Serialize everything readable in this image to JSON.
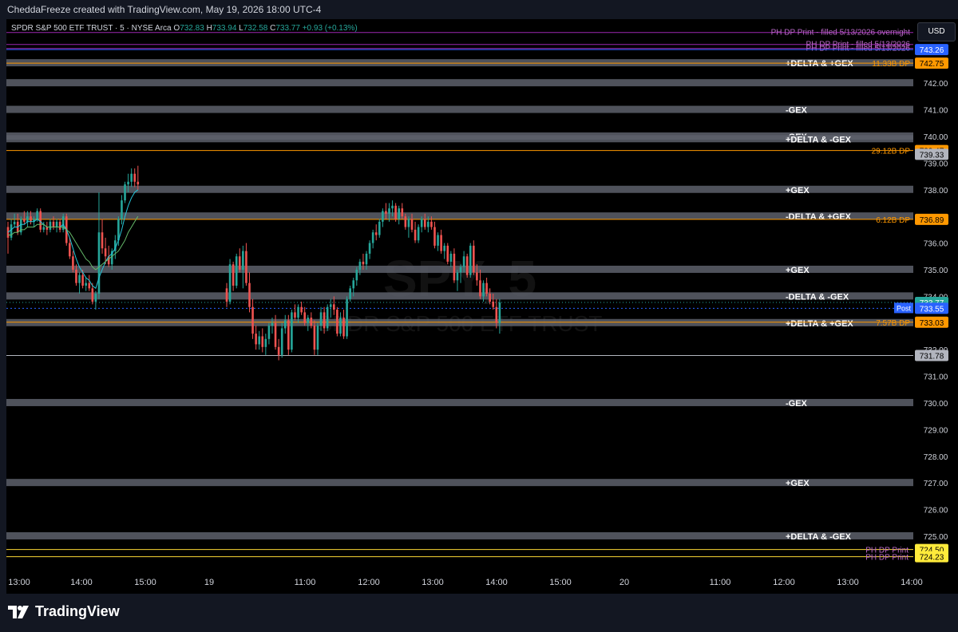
{
  "app": {
    "creator_line": "CheddaFreeze created with TradingView.com, May 19, 2026 18:00 UTC-4",
    "brand": "TradingView"
  },
  "symbol": {
    "name": "SPDR S&P 500 ETF TRUST · 5 · NYSE Arca",
    "open_label": "O",
    "open": "732.83",
    "high_label": "H",
    "high": "733.94",
    "low_label": "L",
    "low": "732.58",
    "close_label": "C",
    "close": "733.77",
    "change": "+0.93 (+0.13%)",
    "watermark_ticker": "SPY, 5",
    "watermark_name": "SPDR S&P 500 ETF TRUST"
  },
  "price_scale": {
    "currency": "USD",
    "ticks": [
      "742.00",
      "741.00",
      "740.00",
      "739.00",
      "738.00",
      "737.00",
      "736.00",
      "735.00",
      "734.00",
      "733.00",
      "732.00",
      "731.00",
      "730.00",
      "729.00",
      "728.00",
      "727.00",
      "726.00",
      "725.00"
    ]
  },
  "time_axis": {
    "labels": [
      "13:00",
      "14:00",
      "15:00",
      "19",
      "11:00",
      "12:00",
      "13:00",
      "14:00",
      "15:00",
      "20",
      "11:00",
      "12:00",
      "13:00",
      "14:00"
    ]
  },
  "levels": {
    "gray_bands": [
      {
        "price": 742.75,
        "label": "+DELTA & +GEX"
      },
      {
        "price": 742.0,
        "label": ""
      },
      {
        "price": 741.0,
        "label": "-GEX"
      },
      {
        "price": 740.0,
        "label": "-GEX"
      },
      {
        "price": 739.9,
        "label": "+DELTA & -GEX"
      },
      {
        "price": 738.0,
        "label": "+GEX"
      },
      {
        "price": 737.0,
        "label": "-DELTA & +GEX"
      },
      {
        "price": 735.0,
        "label": "+GEX"
      },
      {
        "price": 734.0,
        "label": "-DELTA & -GEX"
      },
      {
        "price": 733.0,
        "label": "+DELTA & +GEX"
      },
      {
        "price": 730.0,
        "label": "-GEX"
      },
      {
        "price": 727.0,
        "label": "+GEX"
      },
      {
        "price": 725.0,
        "label": "+DELTA & -GEX"
      }
    ],
    "orange_lines": [
      {
        "price": 742.75,
        "label": "11.33B DP",
        "badge": "742.75"
      },
      {
        "price": 739.47,
        "label": "29.12B DP",
        "badge": "739.47"
      },
      {
        "price": 736.89,
        "label": "6.12B DP",
        "badge": "736.89"
      },
      {
        "price": 733.03,
        "label": "7.57B DP",
        "badge": "733.03"
      }
    ],
    "purple_lines": [
      {
        "price": 743.9,
        "label": "PH DP Print - filled 5/13/2026 overnight"
      },
      {
        "price": 743.45,
        "label": "PH DP Print - filled 5/13/2026"
      },
      {
        "price": 743.3,
        "label": "PH DP Print - filled 5/13/2026"
      }
    ],
    "yellow_lines": [
      {
        "price": 724.5,
        "label": "PH DP Print",
        "badge": "724.50"
      },
      {
        "price": 724.23,
        "label": "PH DP Print",
        "badge": "724.23"
      }
    ],
    "gray_line": {
      "price": 731.78,
      "badge": "731.78"
    },
    "blue_badge": {
      "price": 743.26,
      "badge": "743.26"
    },
    "last_price": {
      "price": 733.77,
      "badge": "733.77"
    },
    "post_price": {
      "price": 733.55,
      "badge": "733.55",
      "tag": "Post"
    },
    "secondary_badge": {
      "price": 739.33,
      "badge": "739.33"
    }
  },
  "colors": {
    "up": "#26a69a",
    "down": "#ef5350",
    "orange": "#ff9800",
    "purple": "#9c27b0",
    "yellow": "#ffeb3b",
    "band": "#5d606b",
    "blue_badge": "#2962ff",
    "teal_ma": "#26c6da",
    "green_ma": "#66bb6a"
  },
  "chart_data": {
    "type": "candlestick",
    "ylim": [
      724.0,
      744.4
    ],
    "candles": [
      [
        736.6,
        736.8,
        735.6,
        736.2
      ],
      [
        736.2,
        736.9,
        736.1,
        736.7
      ],
      [
        736.7,
        737.1,
        736.6,
        736.8
      ],
      [
        736.8,
        737.1,
        736.3,
        736.4
      ],
      [
        736.4,
        737.0,
        736.3,
        736.9
      ],
      [
        736.9,
        737.2,
        736.7,
        736.8
      ],
      [
        736.8,
        737.2,
        736.6,
        737.0
      ],
      [
        737.0,
        737.2,
        736.7,
        736.8
      ],
      [
        736.8,
        737.0,
        736.6,
        736.9
      ],
      [
        736.9,
        737.3,
        736.8,
        737.2
      ],
      [
        737.2,
        737.3,
        736.4,
        736.5
      ],
      [
        736.5,
        736.8,
        736.4,
        736.6
      ],
      [
        736.6,
        736.8,
        736.3,
        736.5
      ],
      [
        736.5,
        736.9,
        736.4,
        736.8
      ],
      [
        736.8,
        737.0,
        736.5,
        736.6
      ],
      [
        736.6,
        736.9,
        736.4,
        736.8
      ],
      [
        736.8,
        736.9,
        736.4,
        736.5
      ],
      [
        736.5,
        737.1,
        736.4,
        737.0
      ],
      [
        737.0,
        737.1,
        735.9,
        736.0
      ],
      [
        736.0,
        736.2,
        735.4,
        735.5
      ],
      [
        735.5,
        735.7,
        734.9,
        735.0
      ],
      [
        735.0,
        735.2,
        734.4,
        734.5
      ],
      [
        734.5,
        734.9,
        734.1,
        734.8
      ],
      [
        734.8,
        735.0,
        734.3,
        734.4
      ],
      [
        734.4,
        734.7,
        734.2,
        734.5
      ],
      [
        734.5,
        734.8,
        734.2,
        734.3
      ],
      [
        734.3,
        734.5,
        733.7,
        733.8
      ],
      [
        733.8,
        734.2,
        733.5,
        734.1
      ],
      [
        734.1,
        737.9,
        733.9,
        736.4
      ],
      [
        736.4,
        736.9,
        735.6,
        735.8
      ],
      [
        735.8,
        736.2,
        735.2,
        735.5
      ],
      [
        735.5,
        735.9,
        735.1,
        735.2
      ],
      [
        735.2,
        735.8,
        735.0,
        735.7
      ],
      [
        735.7,
        736.3,
        735.4,
        736.1
      ],
      [
        736.1,
        737.0,
        735.9,
        736.9
      ],
      [
        736.9,
        737.8,
        736.7,
        737.6
      ],
      [
        737.6,
        738.3,
        737.5,
        738.2
      ],
      [
        738.2,
        738.6,
        737.9,
        738.3
      ],
      [
        738.3,
        738.8,
        738.1,
        738.6
      ],
      [
        738.6,
        738.8,
        738.1,
        738.3
      ],
      [
        738.3,
        738.9,
        738.0,
        738.2
      ]
    ],
    "candles_day2": [
      [
        734.3,
        734.5,
        733.6,
        733.8
      ],
      [
        733.8,
        735.4,
        733.7,
        735.2
      ],
      [
        735.2,
        735.3,
        734.2,
        734.4
      ],
      [
        734.4,
        735.6,
        734.3,
        735.5
      ],
      [
        735.5,
        735.8,
        734.9,
        735.0
      ],
      [
        735.0,
        735.9,
        734.3,
        735.7
      ],
      [
        735.7,
        736.0,
        734.4,
        734.5
      ],
      [
        734.5,
        734.9,
        733.4,
        733.6
      ],
      [
        733.6,
        733.9,
        732.4,
        732.6
      ],
      [
        732.6,
        732.9,
        732.0,
        732.2
      ],
      [
        732.2,
        732.7,
        732.0,
        732.5
      ],
      [
        732.5,
        732.8,
        731.9,
        732.1
      ],
      [
        732.1,
        732.6,
        731.8,
        732.4
      ],
      [
        732.4,
        733.0,
        732.2,
        732.9
      ],
      [
        732.9,
        733.2,
        732.6,
        733.0
      ],
      [
        733.0,
        733.3,
        732.0,
        732.1
      ],
      [
        732.1,
        732.4,
        731.6,
        731.8
      ],
      [
        731.8,
        733.0,
        731.7,
        732.8
      ],
      [
        732.8,
        733.3,
        732.6,
        733.1
      ],
      [
        733.1,
        733.3,
        731.8,
        732.0
      ],
      [
        732.0,
        733.5,
        731.9,
        733.4
      ],
      [
        733.4,
        733.7,
        733.1,
        733.2
      ],
      [
        733.2,
        733.7,
        733.0,
        733.6
      ],
      [
        733.6,
        733.8,
        733.3,
        733.4
      ],
      [
        733.4,
        733.6,
        732.9,
        733.0
      ],
      [
        733.0,
        733.3,
        732.7,
        733.2
      ],
      [
        733.2,
        733.4,
        732.8,
        732.9
      ],
      [
        732.9,
        733.1,
        731.8,
        732.0
      ],
      [
        732.0,
        733.0,
        731.8,
        732.9
      ],
      [
        732.9,
        733.6,
        732.7,
        733.4
      ],
      [
        733.4,
        733.6,
        732.6,
        732.8
      ],
      [
        732.8,
        733.7,
        732.7,
        733.6
      ],
      [
        733.6,
        733.9,
        733.2,
        733.7
      ],
      [
        733.7,
        734.0,
        733.3,
        733.5
      ],
      [
        733.5,
        733.6,
        732.5,
        732.6
      ],
      [
        732.6,
        733.4,
        732.5,
        733.2
      ],
      [
        733.2,
        733.5,
        732.4,
        732.5
      ],
      [
        732.5,
        734.0,
        732.4,
        733.9
      ],
      [
        733.9,
        734.4,
        733.8,
        734.3
      ],
      [
        734.3,
        734.7,
        734.0,
        734.6
      ],
      [
        734.6,
        735.1,
        734.4,
        735.0
      ],
      [
        735.0,
        735.4,
        734.8,
        735.3
      ],
      [
        735.3,
        735.6,
        735.0,
        735.2
      ],
      [
        735.2,
        735.7,
        735.0,
        735.6
      ],
      [
        735.6,
        736.1,
        735.4,
        736.0
      ],
      [
        736.0,
        736.5,
        735.8,
        736.4
      ],
      [
        736.4,
        736.7,
        736.1,
        736.3
      ],
      [
        736.3,
        736.9,
        736.2,
        736.8
      ],
      [
        736.8,
        737.3,
        736.6,
        737.2
      ],
      [
        737.2,
        737.5,
        736.9,
        737.1
      ],
      [
        737.1,
        737.5,
        736.8,
        737.3
      ],
      [
        737.3,
        737.6,
        737.0,
        737.4
      ],
      [
        737.4,
        737.5,
        736.8,
        736.9
      ],
      [
        736.9,
        737.4,
        736.7,
        737.3
      ],
      [
        737.3,
        737.5,
        736.9,
        737.0
      ],
      [
        737.0,
        737.1,
        736.5,
        736.6
      ],
      [
        736.6,
        737.0,
        736.2,
        736.9
      ],
      [
        736.9,
        737.1,
        736.4,
        736.5
      ],
      [
        736.5,
        736.8,
        736.0,
        736.1
      ],
      [
        736.1,
        736.7,
        736.0,
        736.6
      ],
      [
        736.6,
        737.0,
        736.4,
        736.9
      ],
      [
        736.9,
        737.1,
        736.5,
        736.6
      ],
      [
        736.6,
        737.0,
        736.4,
        736.8
      ],
      [
        736.8,
        737.0,
        736.5,
        736.6
      ],
      [
        736.6,
        736.8,
        735.8,
        735.9
      ],
      [
        735.9,
        736.4,
        735.7,
        736.3
      ],
      [
        736.3,
        736.5,
        735.6,
        735.7
      ],
      [
        735.7,
        736.0,
        735.4,
        735.9
      ],
      [
        735.9,
        736.0,
        735.2,
        735.3
      ],
      [
        735.3,
        735.7,
        735.1,
        735.6
      ],
      [
        735.6,
        735.8,
        734.5,
        734.6
      ],
      [
        734.6,
        735.0,
        734.2,
        734.9
      ],
      [
        734.9,
        735.2,
        734.5,
        735.1
      ],
      [
        735.1,
        735.7,
        734.9,
        735.5
      ],
      [
        735.5,
        735.6,
        734.7,
        734.8
      ],
      [
        734.8,
        736.0,
        734.7,
        735.9
      ],
      [
        735.9,
        736.1,
        734.8,
        734.9
      ],
      [
        734.9,
        735.2,
        734.4,
        734.6
      ],
      [
        734.6,
        735.0,
        733.9,
        734.0
      ],
      [
        734.0,
        734.6,
        733.8,
        734.5
      ],
      [
        734.5,
        734.7,
        734.0,
        734.1
      ],
      [
        734.1,
        734.3,
        733.7,
        733.8
      ],
      [
        733.8,
        734.1,
        733.5,
        733.6
      ],
      [
        733.6,
        733.9,
        732.8,
        733.0
      ],
      [
        733.0,
        733.9,
        732.6,
        733.77
      ]
    ],
    "ma_fast": [
      736.4,
      736.5,
      736.6,
      736.6,
      736.7,
      736.7,
      736.8,
      736.8,
      736.8,
      736.9,
      736.8,
      736.7,
      736.6,
      736.6,
      736.6,
      736.6,
      736.6,
      736.7,
      736.5,
      736.2,
      735.8,
      735.4,
      735.1,
      734.9,
      734.7,
      734.6,
      734.4,
      734.3,
      734.7,
      735.0,
      735.3,
      735.5,
      735.6,
      735.8,
      736.1,
      736.5,
      737.0,
      737.4,
      737.7,
      737.9,
      738.0
    ],
    "ma_slow": [
      736.3,
      736.3,
      736.4,
      736.4,
      736.5,
      736.5,
      736.6,
      736.6,
      736.6,
      736.7,
      736.7,
      736.7,
      736.6,
      736.6,
      736.6,
      736.6,
      736.6,
      736.6,
      736.5,
      736.4,
      736.2,
      736.0,
      735.8,
      735.6,
      735.4,
      735.3,
      735.1,
      735.0,
      735.1,
      735.2,
      735.3,
      735.4,
      735.5,
      735.6,
      735.7,
      735.9,
      736.1,
      736.4,
      736.6,
      736.8,
      737.0
    ]
  }
}
